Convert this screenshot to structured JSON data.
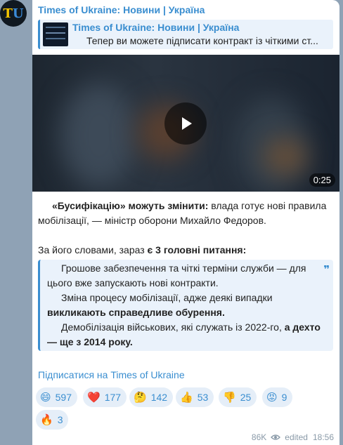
{
  "avatar": {
    "letters_1": "T",
    "letters_2": "U"
  },
  "channel": {
    "name": "Times of Ukraine: Новини | Україна"
  },
  "forward": {
    "title": "Times of Ukraine: Новини | Україна",
    "preview": "Тепер ви можете підписати контракт із чіткими ст..."
  },
  "video": {
    "duration": "0:25",
    "play_icon": "play-icon"
  },
  "message": {
    "p1_bold": "«Бусифікацію» можуть змінити:",
    "p1_rest": " влада готує нові правила мобілізації, — міністр оборони Михайло Федоров.",
    "p2_text": "За його словами, зараз ",
    "p2_bold": "є 3 головні питання:",
    "quote_1": "Грошове забезпечення та чіткі терміни служби — для цього вже запускають нові контракти.",
    "quote_2a": "Зміна процесу мобілізації, адже деякі випадки ",
    "quote_2b": "викликають справедливе обурення.",
    "quote_3a": "Демобілізація військових, які служать із 2022-го, ",
    "quote_3b": "а дехто — ще з 2014 року."
  },
  "subscribe_link": "Підписатися на Times of Ukraine",
  "reactions": [
    {
      "emoji": "😄",
      "count": "597"
    },
    {
      "emoji": "❤️",
      "count": "177"
    },
    {
      "emoji": "🤔",
      "count": "142"
    },
    {
      "emoji": "👍",
      "count": "53"
    },
    {
      "emoji": "👎",
      "count": "25"
    },
    {
      "emoji": "😡",
      "count": "9"
    },
    {
      "emoji": "🔥",
      "count": "3"
    }
  ],
  "meta": {
    "views": "86K",
    "edited": "edited",
    "time": "18:56"
  },
  "colors": {
    "accent": "#3a8ed0",
    "quote_bg": "#eaf2fb",
    "chat_bg": "#8fa2b5"
  }
}
